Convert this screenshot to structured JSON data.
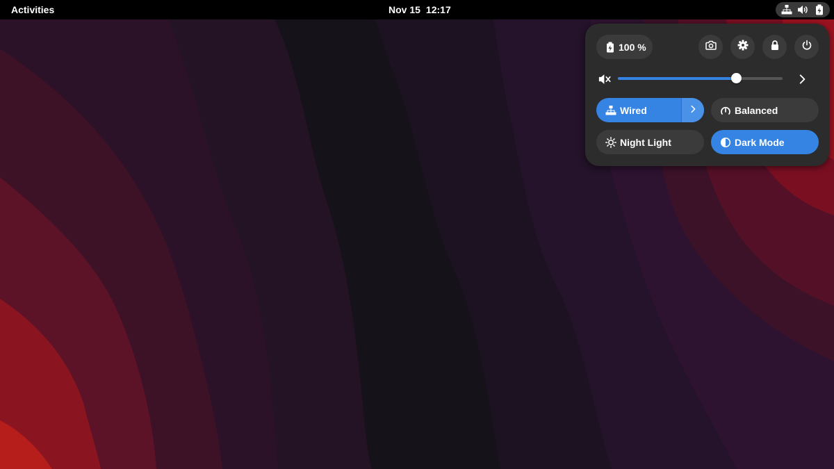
{
  "topbar": {
    "activities_label": "Activities",
    "date": "Nov 15",
    "time": "12:17",
    "status_icons": [
      "network-wired-icon",
      "volume-icon",
      "battery-icon"
    ]
  },
  "quick_settings": {
    "battery": {
      "label": "100 %",
      "icon": "battery-full-charging-icon"
    },
    "system_buttons": [
      "screenshot-icon",
      "settings-gear-icon",
      "lock-icon",
      "power-icon"
    ],
    "volume": {
      "level": 0.72,
      "icon": "volume-muted-icon",
      "expand_icon": "chevron-right-icon"
    },
    "toggles": {
      "wired": {
        "label": "Wired",
        "active": true,
        "icon": "network-wired-icon"
      },
      "power_mode": {
        "label": "Balanced",
        "active": false,
        "icon": "power-profile-icon"
      },
      "night_light": {
        "label": "Night Light",
        "active": false,
        "icon": "night-light-icon"
      },
      "dark_mode": {
        "label": "Dark Mode",
        "active": true,
        "icon": "dark-mode-icon"
      }
    }
  },
  "colors": {
    "accent": "#3584e4",
    "panel": "#2c2c2c",
    "pill": "#3b3b3b",
    "topbar": "#000000"
  }
}
